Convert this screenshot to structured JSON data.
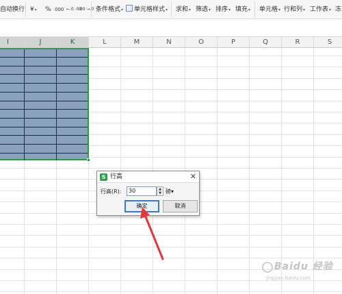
{
  "ribbon": {
    "wrap_text": "自动换行",
    "currency": "¥",
    "percent": "%",
    "thousands": "000",
    "inc_decimal": "←.0 .00",
    "dec_decimal": ".00 →.0",
    "conditional_format": "条件格式",
    "cell_style": "单元格样式",
    "sum": "求和",
    "filter": "筛选",
    "sort": "排序",
    "fill": "填充",
    "cell": "单元格",
    "row_col": "行和列",
    "worksheet": "工作表",
    "freeze": "冻"
  },
  "columns": [
    "I",
    "J",
    "K",
    "L",
    "M",
    "N",
    "O",
    "P",
    "Q",
    "R",
    "S"
  ],
  "dialog": {
    "logo": "S",
    "title": "行高",
    "close": "✕",
    "field_label": "行高(R):",
    "value": "30",
    "unit": "磅▾",
    "ok": "确定",
    "cancel": "取消"
  },
  "colors": {
    "selection_fill": "#8aa2bd",
    "selection_border": "#2e9a44",
    "arrow": "#e8353a",
    "wps_green": "#2aa34a"
  },
  "watermark": {
    "brand": "Baidu 经验",
    "url": "jingyan.baidu.com"
  }
}
